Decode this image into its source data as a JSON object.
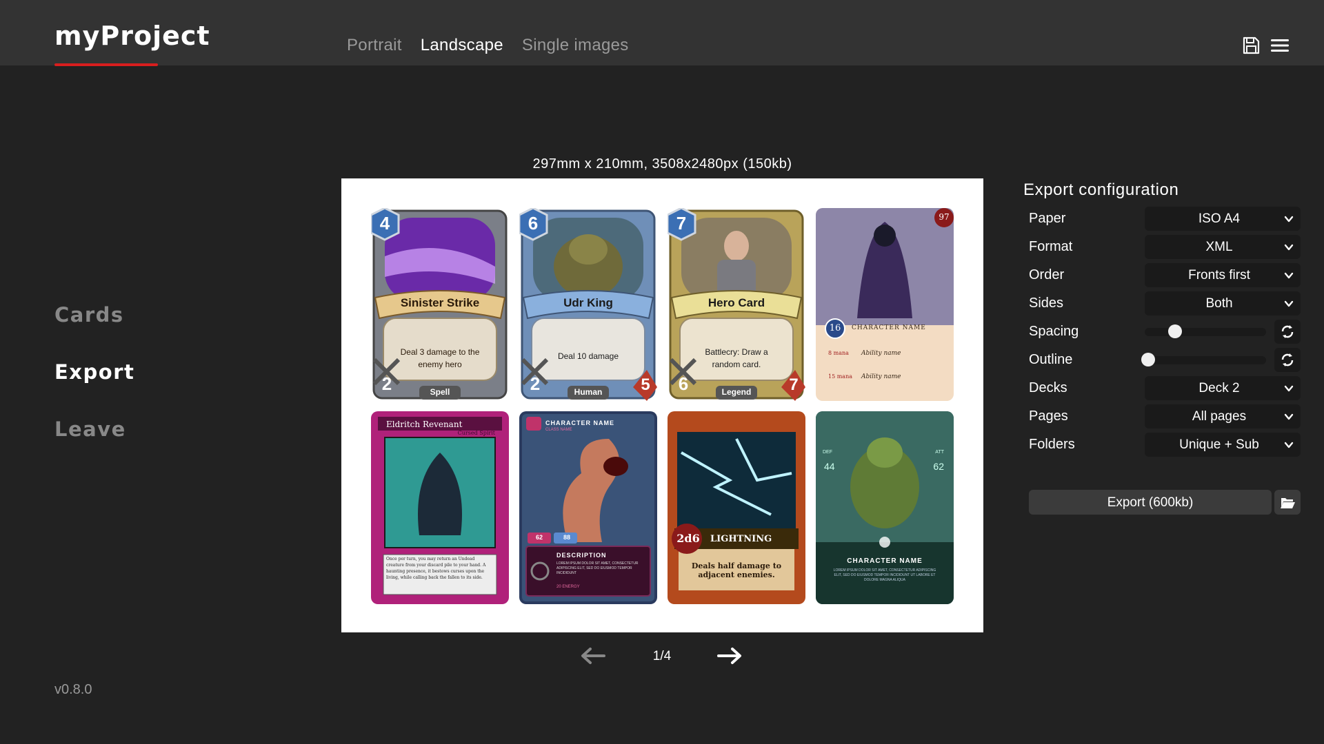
{
  "app": {
    "title": "myProject"
  },
  "tabs": [
    "Portrait",
    "Landscape",
    "Single images"
  ],
  "active_tab": "Landscape",
  "sidebar": {
    "items": [
      "Cards",
      "Export",
      "Leave"
    ],
    "active": "Export"
  },
  "version": "v0.8.0",
  "preview": {
    "caption": "297mm x 210mm, 3508x2480px (150kb)",
    "cards": [
      {
        "title": "Sinister Strike",
        "text": "Deal 3 damage to the enemy hero",
        "cost": "4",
        "attack": "2",
        "type": "Spell",
        "health": "",
        "style": "hearth",
        "frame": "#7b7f88",
        "art": "#6a2aa8"
      },
      {
        "title": "Udr King",
        "text": "Deal 10 damage",
        "cost": "6",
        "attack": "2",
        "type": "Human",
        "health": "5",
        "style": "hearth",
        "frame": "#6f8fb8",
        "art": "#6f6a3a"
      },
      {
        "title": "Hero Card",
        "text": "Battlecry: Draw a random card.",
        "cost": "7",
        "attack": "6",
        "type": "Legend",
        "health": "7",
        "style": "hearth",
        "frame": "#b9a35a",
        "art": "#8a7d62"
      },
      {
        "title": "CHARACTER NAME",
        "text": "Ability name",
        "cost": "16",
        "corner": "97",
        "ability_cost_1": "8 mana",
        "ability_cost_2": "15 mana",
        "ability_2": "Ability name",
        "style": "parchment",
        "frame": "#f3dcc3",
        "art": "#5d4a80"
      },
      {
        "title": "Eldritch Revenant",
        "subtitle": "Cursed Spirit",
        "text": "Once per turn, you may return an Undead creature from your discard pile to your hand. A haunting presence, it bestows curses upon the living, while calling back the fallen to its side.",
        "style": "magic",
        "frame": "#b0217a",
        "art": "#2f9a93"
      },
      {
        "title": "CHARACTER NAME",
        "subtitle": "CLASS NAME",
        "hp": "62",
        "mp": "88",
        "section": "DESCRIPTION",
        "text": "LOREM IPSUM DOLOR SIT AMET, CONSECTETUR ADIPISCING ELIT, SED DO EIUSMOD TEMPOR INCIDIDUNT",
        "cost": "20 ENERGY",
        "style": "dark",
        "frame": "#2a3a5e",
        "art": "#c57a5e"
      },
      {
        "title": "LIGHTNING",
        "dice": "2d6",
        "text": "Deals half damage to adjacent enemies.",
        "style": "spell",
        "frame": "#b44a1d",
        "art": "#0e2b3a"
      },
      {
        "title": "CHARACTER NAME",
        "def_label": "DEF",
        "att_label": "ATT",
        "def": "44",
        "att": "62",
        "text": "LOREM IPSUM DOLOR SIT AMET, CONSECTETUR ADIPISCING ELIT, SED DO EIUSMOD TEMPOR INCIDIDUNT UT LABORE ET DOLORE MAGNA ALIQUA",
        "style": "teal",
        "frame": "#1f4a40",
        "art": "#5f7b36"
      }
    ]
  },
  "pager": {
    "label": "1/4"
  },
  "config": {
    "title": "Export configuration",
    "rows": [
      {
        "label": "Paper",
        "kind": "select",
        "value": "ISO A4"
      },
      {
        "label": "Format",
        "kind": "select",
        "value": "XML"
      },
      {
        "label": "Order",
        "kind": "select",
        "value": "Fronts first"
      },
      {
        "label": "Sides",
        "kind": "select",
        "value": "Both"
      },
      {
        "label": "Spacing",
        "kind": "slider",
        "level": 0.25
      },
      {
        "label": "Outline",
        "kind": "slider",
        "level": 0.03
      },
      {
        "label": "Decks",
        "kind": "select",
        "value": "Deck 2"
      },
      {
        "label": "Pages",
        "kind": "select",
        "value": "All pages"
      },
      {
        "label": "Folders",
        "kind": "select",
        "value": "Unique + Sub"
      }
    ],
    "export_label": "Export (600kb)"
  },
  "icons": {
    "save": "save-icon",
    "menu": "menu-icon",
    "prev": "arrow-left-icon",
    "next": "arrow-right-icon",
    "chevron": "chevron-down-icon",
    "reset": "reset-icon",
    "folder": "folder-open-icon"
  }
}
